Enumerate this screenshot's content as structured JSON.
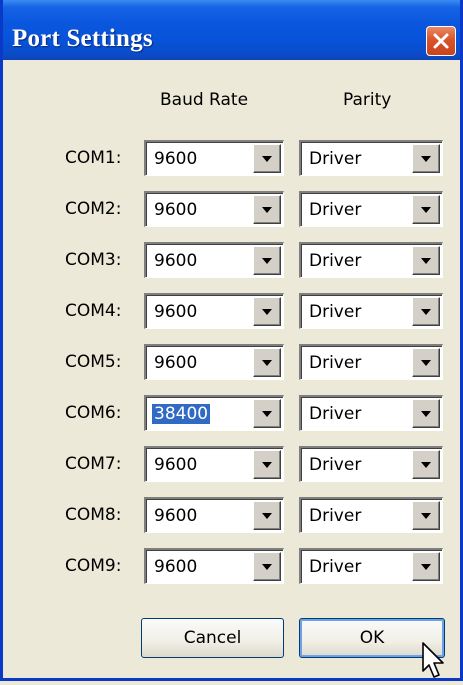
{
  "window": {
    "title": "Port Settings"
  },
  "headers": {
    "baud_rate": "Baud Rate",
    "parity": "Parity"
  },
  "ports": [
    {
      "label": "COM1:",
      "baud": "9600",
      "parity": "Driver"
    },
    {
      "label": "COM2:",
      "baud": "9600",
      "parity": "Driver"
    },
    {
      "label": "COM3:",
      "baud": "9600",
      "parity": "Driver"
    },
    {
      "label": "COM4:",
      "baud": "9600",
      "parity": "Driver"
    },
    {
      "label": "COM5:",
      "baud": "9600",
      "parity": "Driver"
    },
    {
      "label": "COM6:",
      "baud": "38400",
      "parity": "Driver",
      "selected": true
    },
    {
      "label": "COM7:",
      "baud": "9600",
      "parity": "Driver"
    },
    {
      "label": "COM8:",
      "baud": "9600",
      "parity": "Driver"
    },
    {
      "label": "COM9:",
      "baud": "9600",
      "parity": "Driver"
    }
  ],
  "buttons": {
    "cancel": "Cancel",
    "ok": "OK"
  },
  "icons": {
    "close": "close-icon",
    "dropdown": "chevron-down-icon",
    "cursor": "mouse-pointer-icon"
  },
  "colors": {
    "titlebar": "#0a57de",
    "selection": "#316ac5",
    "close": "#d9542b",
    "face": "#ece9d8"
  }
}
